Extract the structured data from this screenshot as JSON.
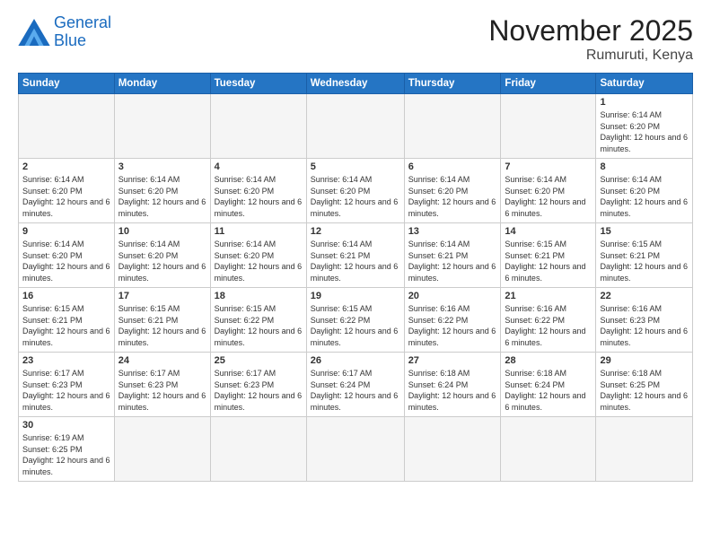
{
  "logo": {
    "line1": "General",
    "line2": "Blue"
  },
  "title": "November 2025",
  "subtitle": "Rumuruti, Kenya",
  "days_of_week": [
    "Sunday",
    "Monday",
    "Tuesday",
    "Wednesday",
    "Thursday",
    "Friday",
    "Saturday"
  ],
  "weeks": [
    [
      {
        "num": "",
        "info": ""
      },
      {
        "num": "",
        "info": ""
      },
      {
        "num": "",
        "info": ""
      },
      {
        "num": "",
        "info": ""
      },
      {
        "num": "",
        "info": ""
      },
      {
        "num": "",
        "info": ""
      },
      {
        "num": "1",
        "info": "Sunrise: 6:14 AM\nSunset: 6:20 PM\nDaylight: 12 hours and 6 minutes."
      }
    ],
    [
      {
        "num": "2",
        "info": "Sunrise: 6:14 AM\nSunset: 6:20 PM\nDaylight: 12 hours and 6 minutes."
      },
      {
        "num": "3",
        "info": "Sunrise: 6:14 AM\nSunset: 6:20 PM\nDaylight: 12 hours and 6 minutes."
      },
      {
        "num": "4",
        "info": "Sunrise: 6:14 AM\nSunset: 6:20 PM\nDaylight: 12 hours and 6 minutes."
      },
      {
        "num": "5",
        "info": "Sunrise: 6:14 AM\nSunset: 6:20 PM\nDaylight: 12 hours and 6 minutes."
      },
      {
        "num": "6",
        "info": "Sunrise: 6:14 AM\nSunset: 6:20 PM\nDaylight: 12 hours and 6 minutes."
      },
      {
        "num": "7",
        "info": "Sunrise: 6:14 AM\nSunset: 6:20 PM\nDaylight: 12 hours and 6 minutes."
      },
      {
        "num": "8",
        "info": "Sunrise: 6:14 AM\nSunset: 6:20 PM\nDaylight: 12 hours and 6 minutes."
      }
    ],
    [
      {
        "num": "9",
        "info": "Sunrise: 6:14 AM\nSunset: 6:20 PM\nDaylight: 12 hours and 6 minutes."
      },
      {
        "num": "10",
        "info": "Sunrise: 6:14 AM\nSunset: 6:20 PM\nDaylight: 12 hours and 6 minutes."
      },
      {
        "num": "11",
        "info": "Sunrise: 6:14 AM\nSunset: 6:20 PM\nDaylight: 12 hours and 6 minutes."
      },
      {
        "num": "12",
        "info": "Sunrise: 6:14 AM\nSunset: 6:21 PM\nDaylight: 12 hours and 6 minutes."
      },
      {
        "num": "13",
        "info": "Sunrise: 6:14 AM\nSunset: 6:21 PM\nDaylight: 12 hours and 6 minutes."
      },
      {
        "num": "14",
        "info": "Sunrise: 6:15 AM\nSunset: 6:21 PM\nDaylight: 12 hours and 6 minutes."
      },
      {
        "num": "15",
        "info": "Sunrise: 6:15 AM\nSunset: 6:21 PM\nDaylight: 12 hours and 6 minutes."
      }
    ],
    [
      {
        "num": "16",
        "info": "Sunrise: 6:15 AM\nSunset: 6:21 PM\nDaylight: 12 hours and 6 minutes."
      },
      {
        "num": "17",
        "info": "Sunrise: 6:15 AM\nSunset: 6:21 PM\nDaylight: 12 hours and 6 minutes."
      },
      {
        "num": "18",
        "info": "Sunrise: 6:15 AM\nSunset: 6:22 PM\nDaylight: 12 hours and 6 minutes."
      },
      {
        "num": "19",
        "info": "Sunrise: 6:15 AM\nSunset: 6:22 PM\nDaylight: 12 hours and 6 minutes."
      },
      {
        "num": "20",
        "info": "Sunrise: 6:16 AM\nSunset: 6:22 PM\nDaylight: 12 hours and 6 minutes."
      },
      {
        "num": "21",
        "info": "Sunrise: 6:16 AM\nSunset: 6:22 PM\nDaylight: 12 hours and 6 minutes."
      },
      {
        "num": "22",
        "info": "Sunrise: 6:16 AM\nSunset: 6:23 PM\nDaylight: 12 hours and 6 minutes."
      }
    ],
    [
      {
        "num": "23",
        "info": "Sunrise: 6:17 AM\nSunset: 6:23 PM\nDaylight: 12 hours and 6 minutes."
      },
      {
        "num": "24",
        "info": "Sunrise: 6:17 AM\nSunset: 6:23 PM\nDaylight: 12 hours and 6 minutes."
      },
      {
        "num": "25",
        "info": "Sunrise: 6:17 AM\nSunset: 6:23 PM\nDaylight: 12 hours and 6 minutes."
      },
      {
        "num": "26",
        "info": "Sunrise: 6:17 AM\nSunset: 6:24 PM\nDaylight: 12 hours and 6 minutes."
      },
      {
        "num": "27",
        "info": "Sunrise: 6:18 AM\nSunset: 6:24 PM\nDaylight: 12 hours and 6 minutes."
      },
      {
        "num": "28",
        "info": "Sunrise: 6:18 AM\nSunset: 6:24 PM\nDaylight: 12 hours and 6 minutes."
      },
      {
        "num": "29",
        "info": "Sunrise: 6:18 AM\nSunset: 6:25 PM\nDaylight: 12 hours and 6 minutes."
      }
    ],
    [
      {
        "num": "30",
        "info": "Sunrise: 6:19 AM\nSunset: 6:25 PM\nDaylight: 12 hours and 6 minutes."
      },
      {
        "num": "",
        "info": ""
      },
      {
        "num": "",
        "info": ""
      },
      {
        "num": "",
        "info": ""
      },
      {
        "num": "",
        "info": ""
      },
      {
        "num": "",
        "info": ""
      },
      {
        "num": "",
        "info": ""
      }
    ]
  ]
}
